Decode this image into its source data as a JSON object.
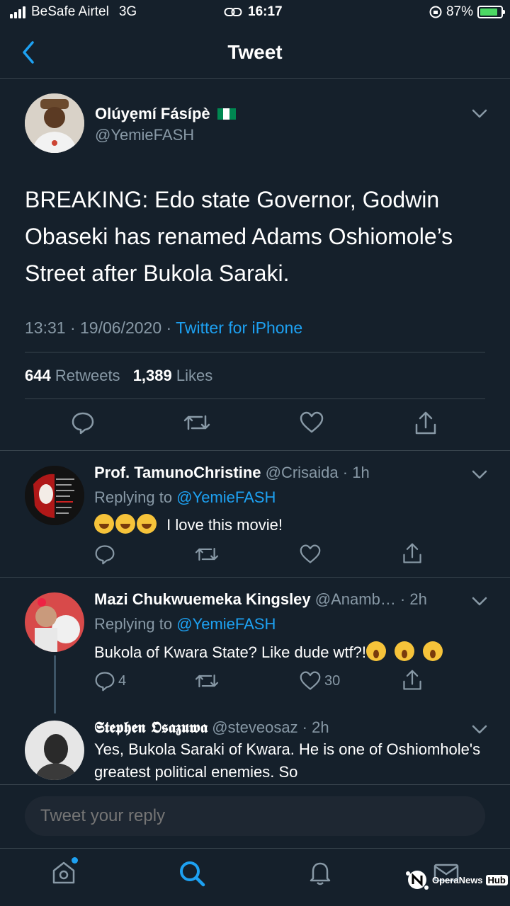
{
  "status_bar": {
    "carrier": "BeSafe Airtel",
    "network": "3G",
    "time": "16:17",
    "battery": "87%",
    "battery_level": 0.87
  },
  "nav": {
    "title": "Tweet"
  },
  "main_tweet": {
    "name": "Olúyẹmí Fásípè",
    "handle": "@YemieFASH",
    "text": "BREAKING: Edo state Governor, Godwin Obaseki has renamed Adams Oshiomole’s Street after Bukola Saraki.",
    "time": "13:31 · 19/06/2020 ·",
    "source": "Twitter for iPhone",
    "retweets_count": "644",
    "retweets_label": "Retweets",
    "likes_count": "1,389",
    "likes_label": "Likes"
  },
  "replies": [
    {
      "name": "Prof. TamunoChristine",
      "handle": "@Crisaida · 1h",
      "replying_label": "Replying to",
      "replying_to": "@YemieFASH",
      "text": "I love this movie!",
      "avatar_text": "RIO TOKYO DENVER NAIROBI HELSINKI BERLIN OSLO"
    },
    {
      "name": "Mazi Chukwuemeka Kingsley",
      "handle": "@Anamb… · 2h",
      "replying_label": "Replying to",
      "replying_to": "@YemieFASH",
      "text": "Bukola of Kwara State? Like dude wtf?!",
      "reply_count": "4",
      "like_count": "30"
    },
    {
      "name": "𝕾𝖙𝖊𝖕𝖍𝖊𝖓 𝕺𝖘𝖆𝖟𝖚𝖜𝖆",
      "handle": "@steveosaz · 2h",
      "text": "Yes, Bukola Saraki of Kwara. He is one of Oshiomhole's greatest political enemies. So"
    }
  ],
  "reply_input": {
    "placeholder": "Tweet your reply"
  },
  "watermark": {
    "text": "OperaNews",
    "badge": "Hub"
  },
  "colors": {
    "background": "#15202b",
    "accent": "#1da1f2",
    "muted": "#8899a6",
    "divider": "#38444d"
  }
}
